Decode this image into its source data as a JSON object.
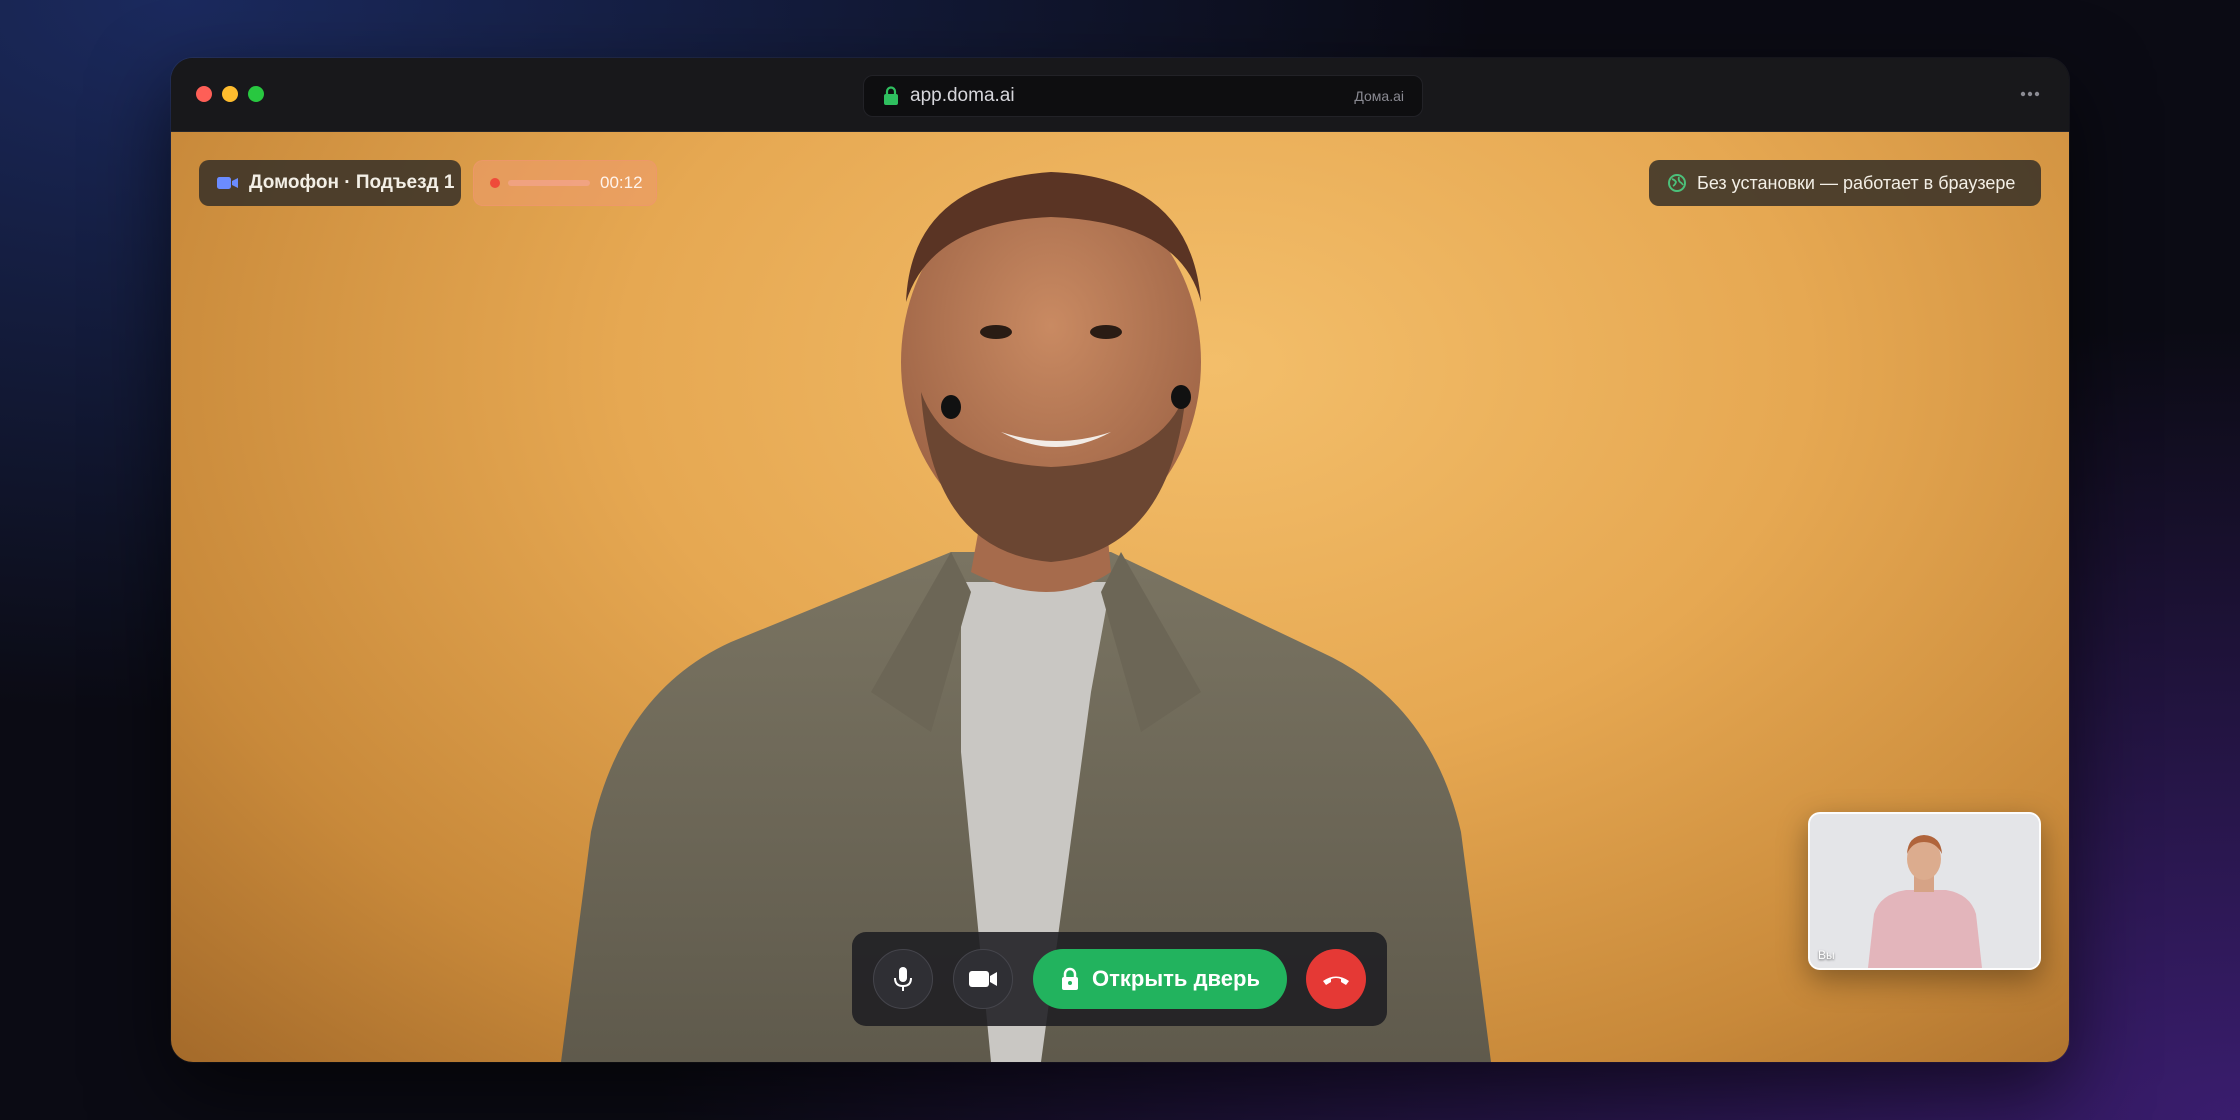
{
  "browser": {
    "url": "app.doma.ai",
    "brand": "Дома.ai"
  },
  "call": {
    "source_label": "Домофон · Подъезд 1",
    "recording_time": "00:12",
    "browser_badge": "Без установки — работает в браузере",
    "self_view_label": "Вы"
  },
  "controls": {
    "open_door_label": "Открыть дверь"
  },
  "icons": {
    "lock": "lock-icon",
    "more": "more-icon",
    "camera": "camera-icon",
    "globe": "globe-icon",
    "mic": "microphone-icon",
    "video": "video-icon",
    "hangup": "phone-hangup-icon"
  },
  "colors": {
    "accent_green": "#22b35e",
    "end_call_red": "#e53935",
    "recording_red": "#ef4b3a",
    "video_background": "#f3be6a"
  }
}
